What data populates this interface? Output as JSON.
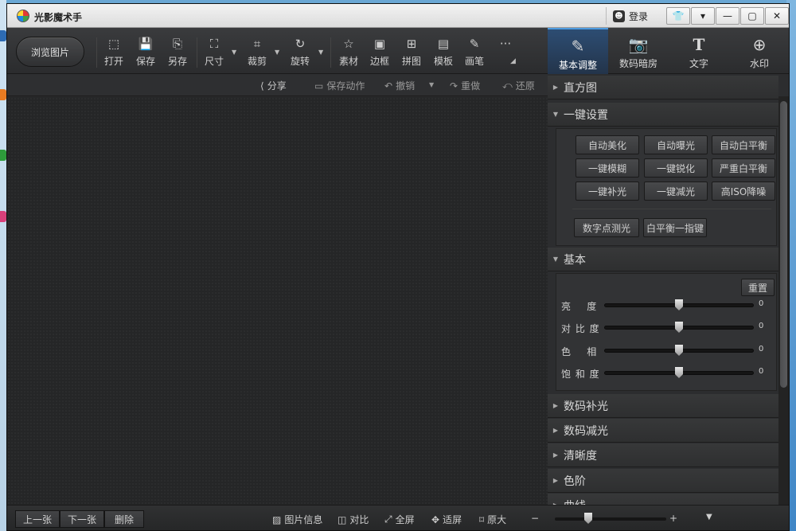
{
  "window": {
    "title": "光影魔术手",
    "login_label": "登录",
    "controls": [
      "shirt-icon",
      "menu-dropdown-icon",
      "minimize-icon",
      "maximize-icon",
      "close-icon"
    ]
  },
  "toolbar": {
    "browse_label": "浏览图片",
    "tools": {
      "open": "打开",
      "save": "保存",
      "save_as": "另存",
      "size": "尺寸",
      "crop": "裁剪",
      "rotate": "旋转",
      "material": "素材",
      "border": "边框",
      "collage": "拼图",
      "template": "模板",
      "brush": "画笔",
      "more": "···"
    }
  },
  "right_tabs": {
    "basic": "基本调整",
    "darkroom": "数码暗房",
    "text": "文字",
    "watermark": "水印",
    "active": "basic"
  },
  "actions": {
    "share": "分享",
    "save_action": "保存动作",
    "undo": "撤销",
    "redo": "重做",
    "restore": "还原"
  },
  "panel": {
    "histogram": "直方图",
    "one_click": {
      "title": "一键设置",
      "buttons": [
        "自动美化",
        "自动曝光",
        "自动白平衡",
        "一键模糊",
        "一键锐化",
        "严重白平衡",
        "一键补光",
        "一键减光",
        "高ISO降噪"
      ],
      "extra_buttons": [
        "数字点测光",
        "白平衡一指键"
      ]
    },
    "basic": {
      "title": "基本",
      "reset": "重置",
      "sliders": [
        {
          "name": "亮    度",
          "value": "0"
        },
        {
          "name": "对 比 度",
          "value": "0"
        },
        {
          "name": "色    相",
          "value": "0"
        },
        {
          "name": "饱 和 度",
          "value": "0"
        }
      ]
    },
    "fill_light": "数码补光",
    "reduce_light": "数码减光",
    "clarity": "清晰度",
    "levels": "色阶",
    "curves": "曲线"
  },
  "statusbar": {
    "prev": "上一张",
    "next": "下一张",
    "delete": "删除",
    "info": "图片信息",
    "compare": "对比",
    "fullscreen": "全屏",
    "fit": "适屏",
    "original": "原大",
    "zoom_minus": "−",
    "zoom_plus": "+",
    "zoom_level": 0.3
  }
}
